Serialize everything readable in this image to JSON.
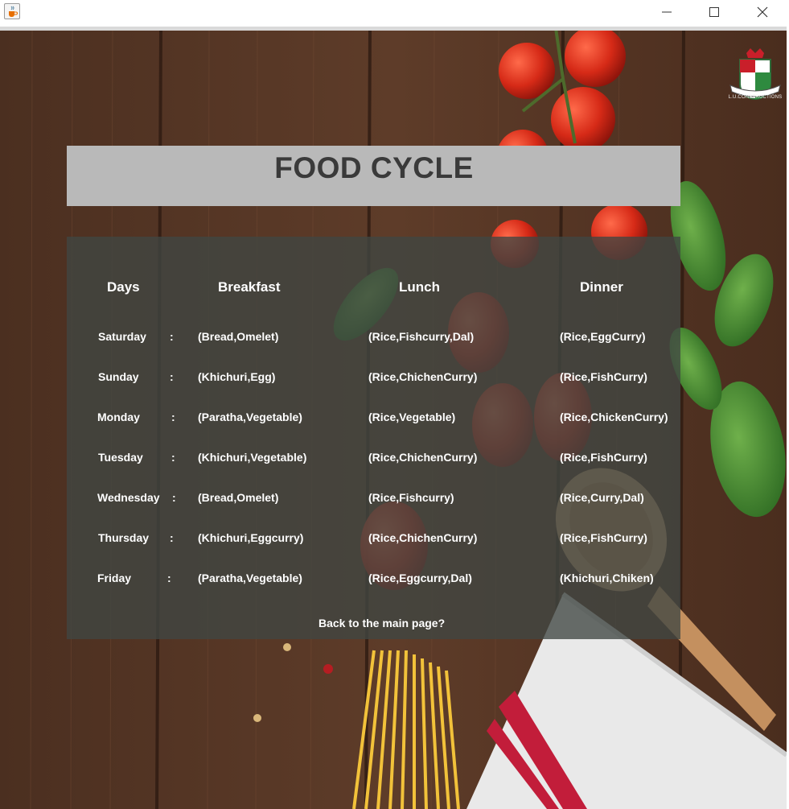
{
  "window": {
    "icons": {
      "app": "java-cup-icon",
      "minimize": "minimize-icon",
      "maximize": "maximize-icon",
      "close": "close-icon"
    }
  },
  "logo": {
    "name": "university-crest-logo",
    "text": "L.U.CONSTRUCTIONS"
  },
  "title": "FOOD CYCLE",
  "table": {
    "headers": {
      "days": "Days",
      "breakfast": "Breakfast",
      "lunch": "Lunch",
      "dinner": "Dinner"
    },
    "separator": ":",
    "rows": [
      {
        "day": "Saturday",
        "breakfast": "(Bread,Omelet)",
        "lunch": "(Rice,Fishcurry,Dal)",
        "dinner": "(Rice,EggCurry)"
      },
      {
        "day": "Sunday",
        "breakfast": "(Khichuri,Egg)",
        "lunch": "(Rice,ChichenCurry)",
        "dinner": "(Rice,FishCurry)"
      },
      {
        "day": "Monday",
        "breakfast": "(Paratha,Vegetable)",
        "lunch": "(Rice,Vegetable)",
        "dinner": "(Rice,ChickenCurry)"
      },
      {
        "day": "Tuesday",
        "breakfast": "(Khichuri,Vegetable)",
        "lunch": "(Rice,ChichenCurry)",
        "dinner": "(Rice,FishCurry)"
      },
      {
        "day": "Wednesday",
        "breakfast": "(Bread,Omelet)",
        "lunch": "(Rice,Fishcurry)",
        "dinner": "(Rice,Curry,Dal)"
      },
      {
        "day": "Thursday",
        "breakfast": "(Khichuri,Eggcurry)",
        "lunch": "(Rice,ChichenCurry)",
        "dinner": "(Rice,FishCurry)"
      },
      {
        "day": "Friday",
        "breakfast": "(Paratha,Vegetable)",
        "lunch": "(Rice,Eggcurry,Dal)",
        "dinner": "(Khichuri,Chiken)"
      }
    ]
  },
  "back_link": "Back to the main page?",
  "colors": {
    "banner": "#b9b9b9",
    "title": "#3a3a3a",
    "panel": "#404642",
    "text": "#ffffff",
    "wood": "#5a3a28"
  }
}
